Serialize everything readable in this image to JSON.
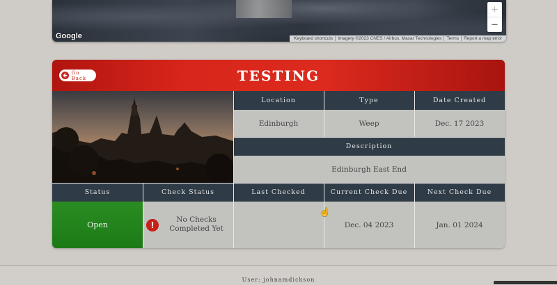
{
  "map": {
    "logo": "Google",
    "attribution": [
      "Keyboard shortcuts",
      "Imagery ©2023 CNES / Airbus, Maxar Technologies",
      "Terms",
      "Report a map error"
    ],
    "zoom_in": "+",
    "zoom_out": "−"
  },
  "card": {
    "title": "TESTING",
    "back_label": "Go Back",
    "accent_color": "#d9261c",
    "headers": {
      "location": "Location",
      "type": "Type",
      "date_created": "Date Created",
      "description": "Description",
      "status": "Status",
      "check_status": "Check Status",
      "last_checked": "Last Checked",
      "current_check_due": "Current Check Due",
      "next_check_due": "Next Check Due"
    },
    "values": {
      "location": "Edinburgh",
      "type": "Weep",
      "date_created": "Dec. 17 2023",
      "description": "Edinburgh East End",
      "status": "Open",
      "check_status": "No Checks Completed Yet",
      "last_checked": "",
      "current_check_due": "Dec. 04 2023",
      "next_check_due": "Jan. 01 2024"
    },
    "status_color": "#2a8c22",
    "warning_icon": "!"
  },
  "footer": {
    "user": "User: johnamdickson"
  }
}
